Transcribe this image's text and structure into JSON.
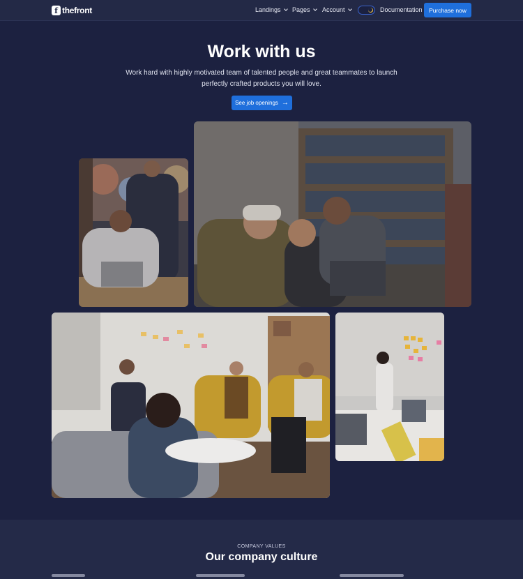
{
  "brand": {
    "name": "thefront",
    "mark": "f"
  },
  "nav": {
    "items": [
      {
        "label": "Landings"
      },
      {
        "label": "Pages"
      },
      {
        "label": "Account"
      }
    ],
    "documentation": "Documentation",
    "purchase": "Purchase now"
  },
  "hero": {
    "title": "Work with us",
    "subtitle": "Work hard with highly motivated team of talented people and great teammates to launch perfectly crafted products you will love.",
    "button": "See job openings"
  },
  "culture": {
    "eyebrow": "COMPANY VALUES",
    "title": "Our company culture"
  },
  "colors": {
    "background": "#1c2140",
    "header": "#232946",
    "accent": "#1f6fdc",
    "section": "#242a48"
  },
  "icons": [
    "logo-icon",
    "chevron-down-icon",
    "theme-toggle-icon",
    "arrow-right-icon"
  ]
}
